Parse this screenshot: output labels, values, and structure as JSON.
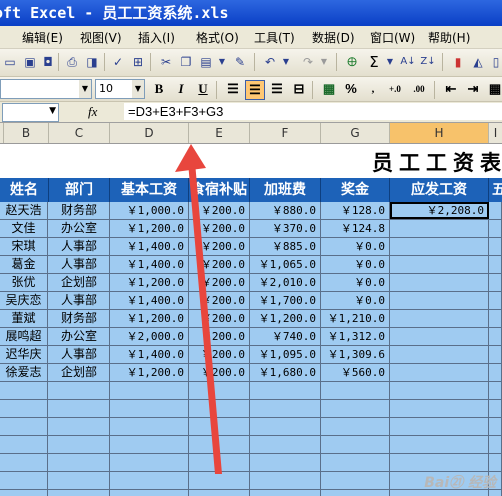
{
  "window": {
    "title": "oft Excel - 员工工资系统.xls"
  },
  "menu": [
    "编辑(E)",
    "视图(V)",
    "插入(I)",
    "格式(O)",
    "工具(T)",
    "数据(D)",
    "窗口(W)",
    "帮助(H)"
  ],
  "font_size": {
    "value": "10"
  },
  "formula_bar": {
    "formula": "=D3+E3+F3+G3",
    "fx": "fx"
  },
  "columns": [
    "B",
    "C",
    "D",
    "E",
    "F",
    "G",
    "H",
    "I"
  ],
  "sheet": {
    "title": "员工工资表",
    "headers": [
      "姓名",
      "部门",
      "基本工资",
      "食宿补贴",
      "加班费",
      "奖金",
      "应发工资",
      "五"
    ],
    "rows": [
      [
        "赵天浩",
        "财务部",
        "￥1,000.0",
        "￥200.0",
        "￥880.0",
        "￥128.0",
        "￥2,208.0"
      ],
      [
        "文佳",
        "办公室",
        "￥1,200.0",
        "￥200.0",
        "￥370.0",
        "￥124.8",
        ""
      ],
      [
        "宋琪",
        "人事部",
        "￥1,400.0",
        "￥200.0",
        "￥885.0",
        "￥0.0",
        ""
      ],
      [
        "葛金",
        "人事部",
        "￥1,400.0",
        "￥200.0",
        "￥1,065.0",
        "￥0.0",
        ""
      ],
      [
        "张优",
        "企划部",
        "￥1,200.0",
        "￥200.0",
        "￥2,010.0",
        "￥0.0",
        ""
      ],
      [
        "吴庆恋",
        "人事部",
        "￥1,400.0",
        "￥200.0",
        "￥1,700.0",
        "￥0.0",
        ""
      ],
      [
        "董斌",
        "财务部",
        "￥1,200.0",
        "￥200.0",
        "￥1,200.0",
        "￥1,210.0",
        ""
      ],
      [
        "展鸣超",
        "办公室",
        "￥2,000.0",
        "￥200.0",
        "￥740.0",
        "￥1,312.0",
        ""
      ],
      [
        "迟华庆",
        "人事部",
        "￥1,400.0",
        "￥200.0",
        "￥1,095.0",
        "￥1,309.6",
        ""
      ],
      [
        "徐爱志",
        "企划部",
        "￥1,200.0",
        "￥200.0",
        "￥1,680.0",
        "￥560.0",
        ""
      ]
    ]
  },
  "watermark": "Baidu 经验"
}
